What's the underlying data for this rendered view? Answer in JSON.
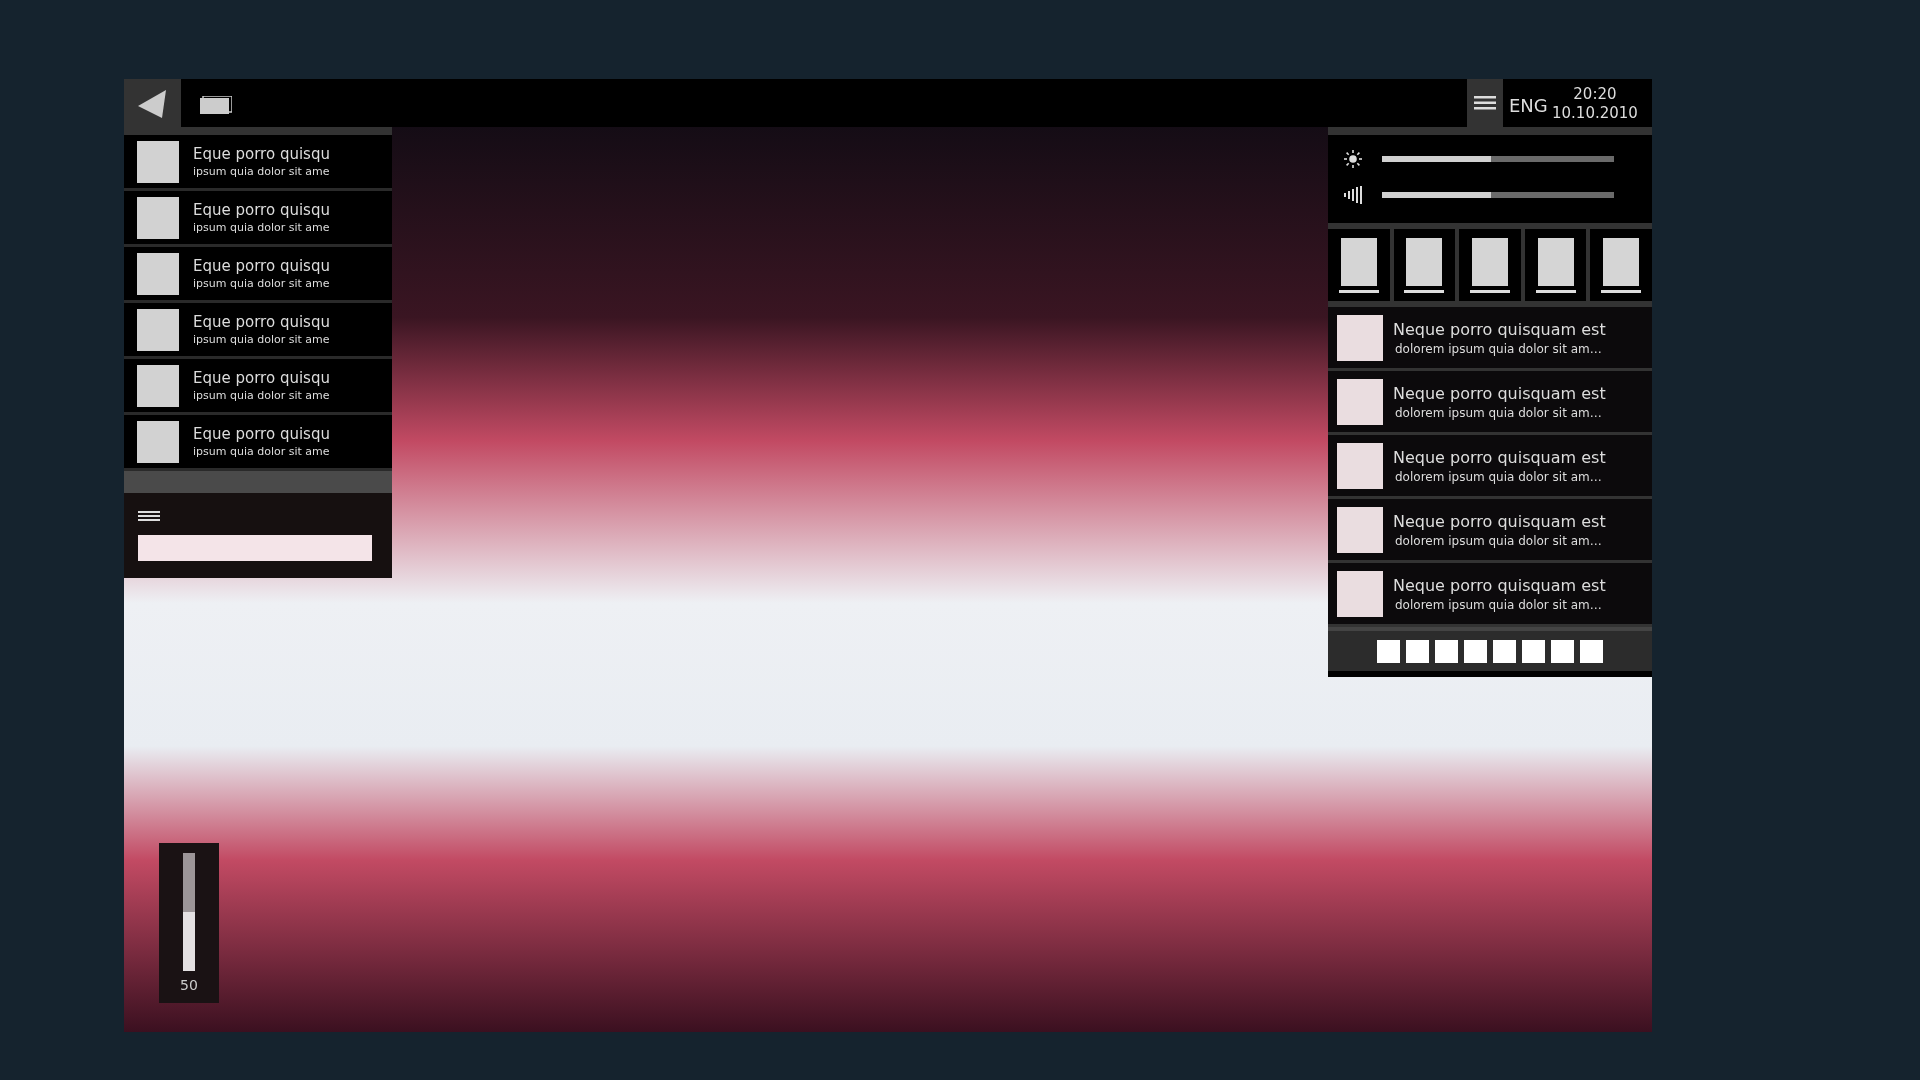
{
  "top_bar": {
    "language": "ENG",
    "time": "20:20",
    "date": "10.10.2010"
  },
  "left_panel": {
    "items": [
      {
        "title": "Eque porro quisqu",
        "subtitle": "ipsum quia dolor sit ame"
      },
      {
        "title": "Eque porro quisqu",
        "subtitle": "ipsum quia dolor sit ame"
      },
      {
        "title": "Eque porro quisqu",
        "subtitle": "ipsum quia dolor sit ame"
      },
      {
        "title": "Eque porro quisqu",
        "subtitle": "ipsum quia dolor sit ame"
      },
      {
        "title": "Eque porro quisqu",
        "subtitle": "ipsum quia dolor sit ame"
      },
      {
        "title": "Eque porro quisqu",
        "subtitle": "ipsum quia dolor sit ame"
      }
    ]
  },
  "right_panel": {
    "sliders": [
      {
        "kind": "brightness",
        "level": 0.47
      },
      {
        "kind": "volume",
        "level": 0.47
      }
    ],
    "items": [
      {
        "title": "Neque porro quisquam est",
        "subtitle": "dolorem ipsum quia dolor sit am…"
      },
      {
        "title": "Neque porro quisquam est",
        "subtitle": "dolorem ipsum quia dolor sit am…"
      },
      {
        "title": "Neque porro quisquam est",
        "subtitle": "dolorem ipsum quia dolor sit am…"
      },
      {
        "title": "Neque porro quisquam est",
        "subtitle": "dolorem ipsum quia dolor sit am…"
      },
      {
        "title": "Neque porro quisquam est",
        "subtitle": "dolorem ipsum quia dolor sit am…"
      }
    ]
  },
  "volume_slider": {
    "level": 0.5,
    "reading": "50"
  }
}
